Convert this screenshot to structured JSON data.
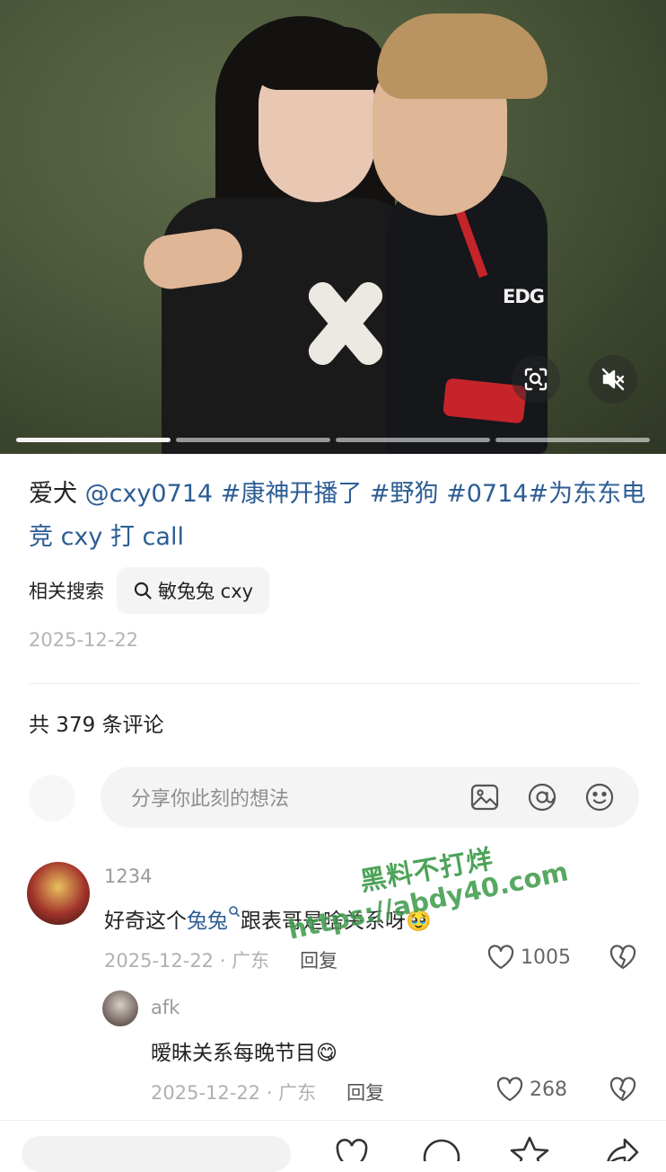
{
  "media": {
    "jersey_text": "EDG",
    "progress": {
      "segments": 4,
      "active_index": 0
    },
    "buttons": {
      "scan_icon": "scan-icon",
      "mute_icon": "mute-icon"
    }
  },
  "post": {
    "caption_prefix": "爱犬 ",
    "caption_tags": [
      "@cxy0714",
      " #康神开播了",
      " #野狗",
      " #0714",
      "#为东东电竞 cxy 打 call"
    ],
    "related_label": "相关搜索",
    "related_query": "敏兔兔 cxy",
    "date": "2025-12-22"
  },
  "comments_header": {
    "count_text": "共 379 条评论"
  },
  "comment_input": {
    "placeholder": "分享你此刻的想法"
  },
  "comments": [
    {
      "user": "1234",
      "text_before": "好奇这个",
      "keyword": "兔兔",
      "text_after": "跟表哥是啥关系呀",
      "emoji": "🥹",
      "date_loc": "2025-12-22 · 广东",
      "reply_label": "回复",
      "likes": "1005"
    },
    {
      "user": "afk",
      "text": "暧昧关系每晚节目",
      "emoji": "😋",
      "date_loc": "2025-12-22 · 广东",
      "reply_label": "回复",
      "likes": "268"
    }
  ],
  "watermark": {
    "line1": "黑料不打烊",
    "line2": "https://abdy40.com"
  },
  "colors": {
    "link": "#2c5d94",
    "muted": "#b0b0b0",
    "watermark": "#3a9a48"
  }
}
